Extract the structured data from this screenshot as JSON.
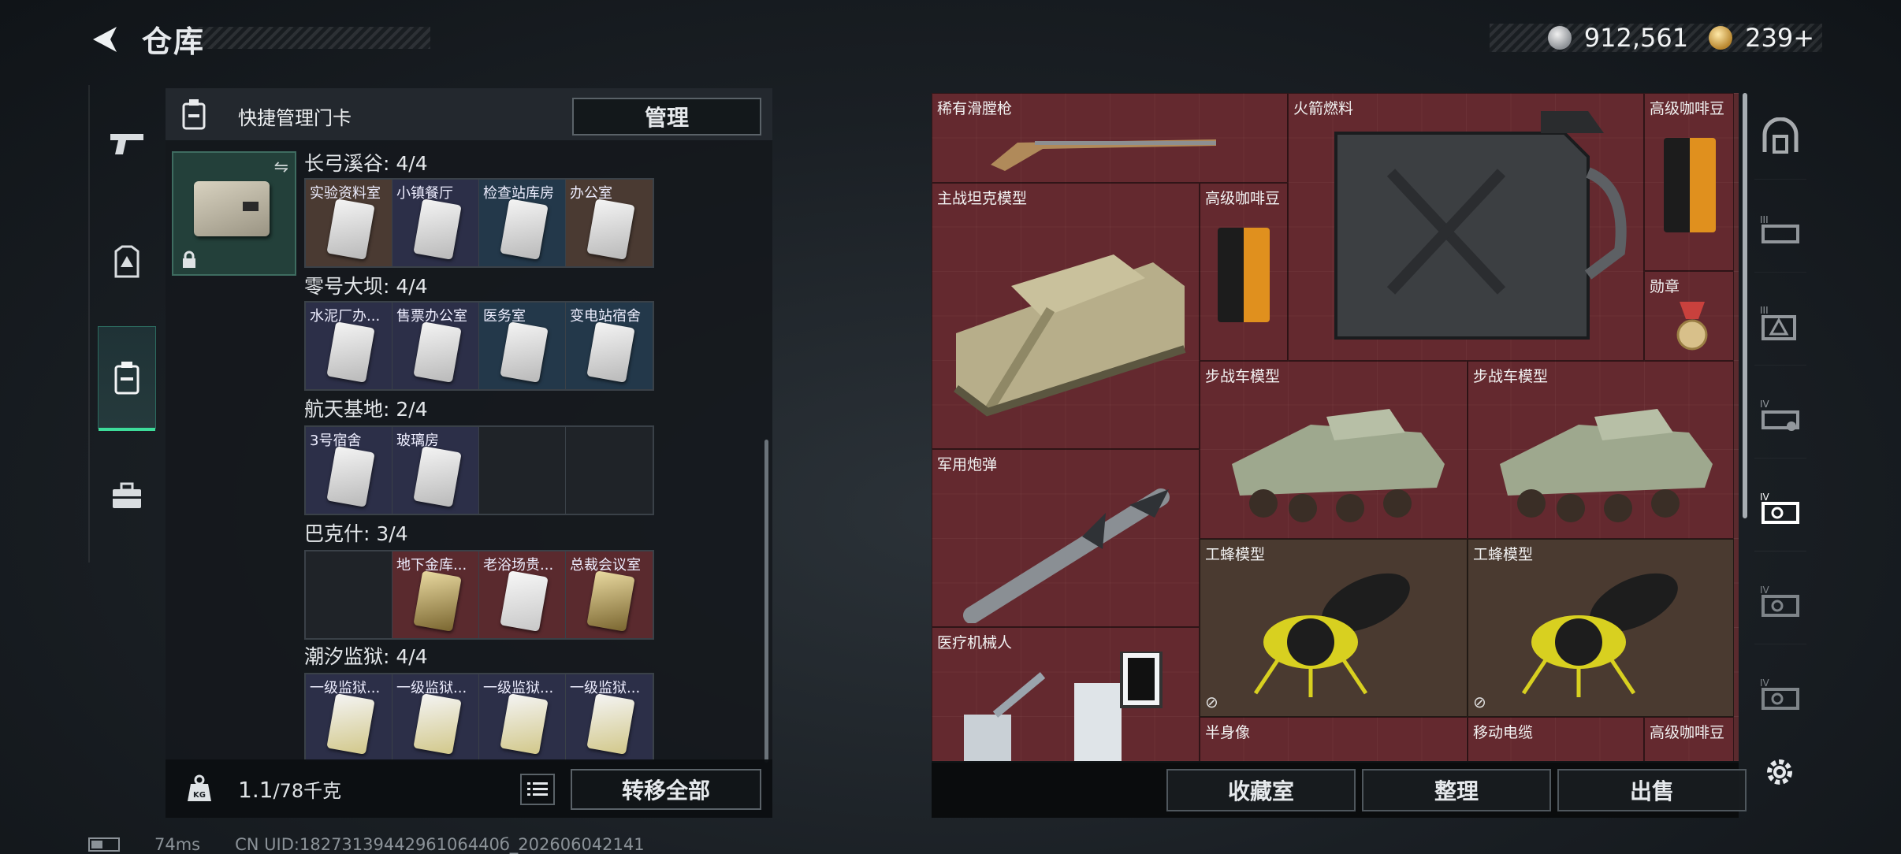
{
  "header": {
    "title": "仓库",
    "currencies": [
      {
        "icon": "silver-coin-icon",
        "value": "912,561"
      },
      {
        "icon": "gold-coin-icon",
        "value": "239+"
      }
    ]
  },
  "left_nav": [
    {
      "name": "weapons",
      "icon": "pistol-icon"
    },
    {
      "name": "equipment",
      "icon": "armor-icon"
    },
    {
      "name": "keycards",
      "icon": "keycard-icon",
      "active": true
    },
    {
      "name": "supplies",
      "icon": "toolbox-icon"
    }
  ],
  "keycard_panel": {
    "quick_label": "快捷管理门卡",
    "manage_label": "管理",
    "regions": [
      {
        "title": "长弓溪谷: 4/4",
        "slots": [
          "实验资料室",
          "小镇餐厅",
          "检查站库房",
          "办公室"
        ]
      },
      {
        "title": "零号大坝: 4/4",
        "slots": [
          "水泥厂办...",
          "售票办公室",
          "医务室",
          "变电站宿舍"
        ]
      },
      {
        "title": "航天基地: 2/4",
        "slots": [
          "3号宿舍",
          "玻璃房",
          "",
          ""
        ]
      },
      {
        "title": "巴克什: 3/4",
        "slots": [
          "",
          "地下金库...",
          "老浴场贵...",
          "总裁会议室"
        ]
      },
      {
        "title": "潮汐监狱: 4/4",
        "slots": [
          "一级监狱...",
          "一级监狱...",
          "一级监狱...",
          "一级监狱..."
        ]
      }
    ],
    "weight_value": "1.1",
    "weight_capacity": "/78千克",
    "transfer_all_label": "转移全部"
  },
  "status": {
    "ping": "74ms",
    "uid": "CN UID:1827313944296106440б_202606042141"
  },
  "stash": {
    "items": [
      {
        "label": "稀有滑膛枪"
      },
      {
        "label": "火箭燃料"
      },
      {
        "label": "高级咖啡豆"
      },
      {
        "label": "主战坦克模型"
      },
      {
        "label": "高级咖啡豆"
      },
      {
        "label": "勋章"
      },
      {
        "label": "步战车模型"
      },
      {
        "label": "步战车模型"
      },
      {
        "label": "军用炮弹"
      },
      {
        "label": "工蜂模型"
      },
      {
        "label": "工蜂模型"
      },
      {
        "label": "医疗机械人"
      },
      {
        "label": "半身像"
      },
      {
        "label": "移动电缆"
      },
      {
        "label": "高级咖啡豆"
      }
    ],
    "footer_buttons": [
      "收藏室",
      "整理",
      "出售"
    ]
  },
  "category_nav": [
    {
      "icon": "all-items-icon"
    },
    {
      "icon": "tier3-slot-icon",
      "tier": "III"
    },
    {
      "icon": "tier3-triangle-icon",
      "tier": "III"
    },
    {
      "icon": "tier4-card-icon",
      "tier": "IV"
    },
    {
      "icon": "tier4-projector-icon",
      "tier": "IV",
      "active": true
    },
    {
      "icon": "tier4-projector-icon",
      "tier": "IV"
    },
    {
      "icon": "tier4-projector-icon",
      "tier": "IV"
    }
  ],
  "colors": {
    "accent_green": "#3ddc9a",
    "stash_red": "#5a2a2e",
    "panel_dark": "#14181c"
  }
}
